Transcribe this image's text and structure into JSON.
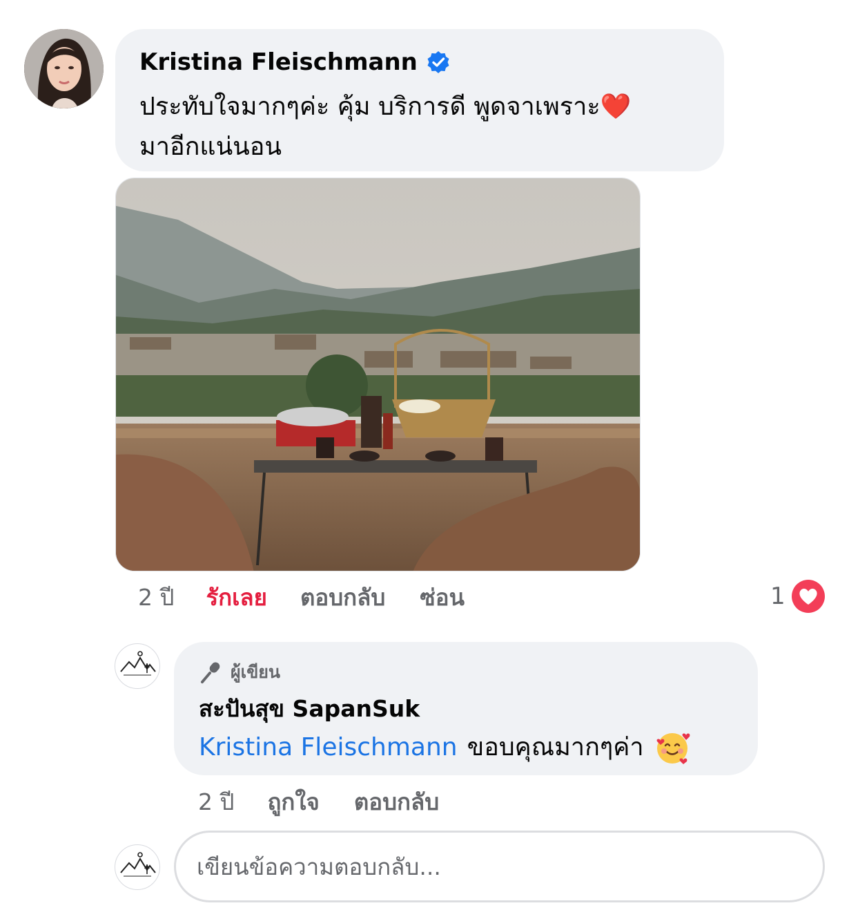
{
  "comment": {
    "author": "Kristina Fleischmann",
    "verified": true,
    "text": "ประทับใจมากๆค่ะ คุ้ม บริการดี พูดจาเพราะ❤️\nมาอีกแน่นอน",
    "time": "2 ปี",
    "actions": {
      "love": "รักเลย",
      "reply": "ตอบกลับ",
      "hide": "ซ่อน"
    },
    "reaction_count": "1",
    "reaction_icon": "heart-reaction-icon",
    "reaction_color": "#f33e58"
  },
  "reply": {
    "badge": "ผู้เขียน",
    "author": "สะปันสุข SapanSuk",
    "mention": "Kristina Fleischmann",
    "text": "ขอบคุณมากๆค่า",
    "emoji_icon": "smiling-face-with-hearts-icon",
    "time": "2 ปี",
    "actions": {
      "like": "ถูกใจ",
      "reply": "ตอบกลับ"
    }
  },
  "composer": {
    "placeholder": "เขียนข้อความตอบกลับ..."
  },
  "colors": {
    "bubble": "#f0f2f5",
    "mention": "#1b74e4",
    "loved": "#e41e3f",
    "muted": "#65676b",
    "verified": "#1877f2"
  }
}
